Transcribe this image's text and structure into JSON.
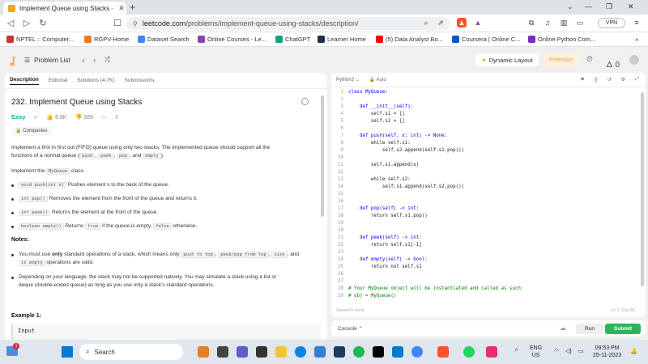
{
  "browser": {
    "tab_title": "Implement Queue using Stacks -",
    "url_host": "leetcode.com",
    "url_path": "/problems/implement-queue-using-stacks/description/",
    "vpn_label": "VPN"
  },
  "bookmarks": [
    {
      "label": "NPTEL :: Computer...",
      "color": "#c0392b"
    },
    {
      "label": "RGPV-Home",
      "color": "#e67e22"
    },
    {
      "label": "Dataset Search",
      "color": "#4285f4"
    },
    {
      "label": "Online Courses - Le...",
      "color": "#8e44ad"
    },
    {
      "label": "ChatGPT",
      "color": "#10a37f"
    },
    {
      "label": "Learner Home",
      "color": "#1f2f46"
    },
    {
      "label": "(5) Data Analyst Bo...",
      "color": "#ff0000"
    },
    {
      "label": "Coursera | Online C...",
      "color": "#0056d2"
    },
    {
      "label": "Online Python Com...",
      "color": "#7b2cbf"
    }
  ],
  "lc_header": {
    "problem_list": "Problem List",
    "dynamic_layout": "Dynamic Layout",
    "premium": "Premium",
    "streak": "0"
  },
  "problem": {
    "tabs": [
      "Description",
      "Editorial",
      "Solutions (4.7K)",
      "Submissions"
    ],
    "title": "232. Implement Queue using Stacks",
    "difficulty": "Easy",
    "likes": "6.8K",
    "dislikes": "389",
    "companies": "Companies",
    "para1a": "Implement a first in first out (FIFO) queue using only two stacks. The implemented queue should support all the",
    "para1b": "functions of a normal queue (",
    "push": "push",
    "peek": "peek",
    "pop": "pop",
    "empty": "empty",
    "para1c": ").",
    "para2a": "Implement the",
    "myqueue": "MyQueue",
    "para2b": "class:",
    "b1_code": "void push(int x)",
    "b1_text": "Pushes element x to the back of the queue.",
    "b2_code": "int pop()",
    "b2_text": "Removes the element from the front of the queue and returns it.",
    "b3_code": "int peek()",
    "b3_text": "Returns the element at the front of the queue.",
    "b4_code": "boolean empty()",
    "b4_text": "Returns",
    "b4_true": "true",
    "b4_mid": "if the queue is empty,",
    "b4_false": "false",
    "b4_end": "otherwise.",
    "notes": "Notes:",
    "n1a": "You must use",
    "n1only": "only",
    "n1b": "standard operations of a stack, which means only",
    "n1c1": "push to top",
    "n1c2": "peek/pop from top",
    "n1c3": "size",
    "n1c4": "is empty",
    "n1d": "and",
    "n1e": "operations are valid.",
    "n2a": "Depending on your language, the stack may not be supported natively. You may simulate a stack using a list or",
    "n2b": "deque (double-ended queue) as long as you use only a stack's standard operations.",
    "example": "Example 1:",
    "input_label": "Input"
  },
  "editor": {
    "language": "Python3",
    "mode": "Auto",
    "code_lines": [
      {
        "n": "1",
        "t": "class MyQueue:",
        "c": "kw"
      },
      {
        "n": "2",
        "t": "",
        "c": ""
      },
      {
        "n": "3",
        "t": "    def __init__(self):",
        "c": "kw"
      },
      {
        "n": "4",
        "t": "        self.s1 = []",
        "c": ""
      },
      {
        "n": "5",
        "t": "        self.s2 = []",
        "c": ""
      },
      {
        "n": "6",
        "t": "",
        "c": ""
      },
      {
        "n": "7",
        "t": "    def push(self, x: int) -> None:",
        "c": "kw"
      },
      {
        "n": "8",
        "t": "        while self.s1:",
        "c": ""
      },
      {
        "n": "9",
        "t": "            self.s2.append(self.s1.pop())",
        "c": ""
      },
      {
        "n": "10",
        "t": "",
        "c": ""
      },
      {
        "n": "11",
        "t": "        self.s1.append(x)",
        "c": ""
      },
      {
        "n": "12",
        "t": "",
        "c": ""
      },
      {
        "n": "13",
        "t": "        while self.s2:",
        "c": ""
      },
      {
        "n": "14",
        "t": "            self.s1.append(self.s2.pop())",
        "c": ""
      },
      {
        "n": "15",
        "t": "",
        "c": ""
      },
      {
        "n": "16",
        "t": "",
        "c": ""
      },
      {
        "n": "17",
        "t": "    def pop(self) -> int:",
        "c": "kw"
      },
      {
        "n": "18",
        "t": "        return self.s1.pop()",
        "c": ""
      },
      {
        "n": "19",
        "t": "",
        "c": ""
      },
      {
        "n": "20",
        "t": "",
        "c": ""
      },
      {
        "n": "21",
        "t": "    def peek(self) -> int:",
        "c": "kw"
      },
      {
        "n": "22",
        "t": "        return self.s1[-1]",
        "c": ""
      },
      {
        "n": "23",
        "t": "",
        "c": ""
      },
      {
        "n": "24",
        "t": "    def empty(self) -> bool:",
        "c": "kw"
      },
      {
        "n": "25",
        "t": "        return not self.s1",
        "c": ""
      },
      {
        "n": "26",
        "t": "",
        "c": ""
      },
      {
        "n": "27",
        "t": "",
        "c": ""
      },
      {
        "n": "28",
        "t": "# Your MyQueue object will be instantiated and called as such:",
        "c": "cm"
      },
      {
        "n": "29",
        "t": "# obj = MyQueue()",
        "c": "cm"
      }
    ],
    "saved": "Saved to local",
    "cursor": "Ln 7, Col 36"
  },
  "console": {
    "label": "Console",
    "run": "Run",
    "submit": "Submit"
  },
  "taskbar": {
    "search": "Search",
    "lang1": "ENG",
    "lang2": "US",
    "time": "09:53 PM",
    "date": "25-11-2023",
    "notif": "1"
  },
  "colors": {
    "easy": "#00b8a3",
    "submit": "#2db55d",
    "leetcode": "#f89f1b"
  }
}
